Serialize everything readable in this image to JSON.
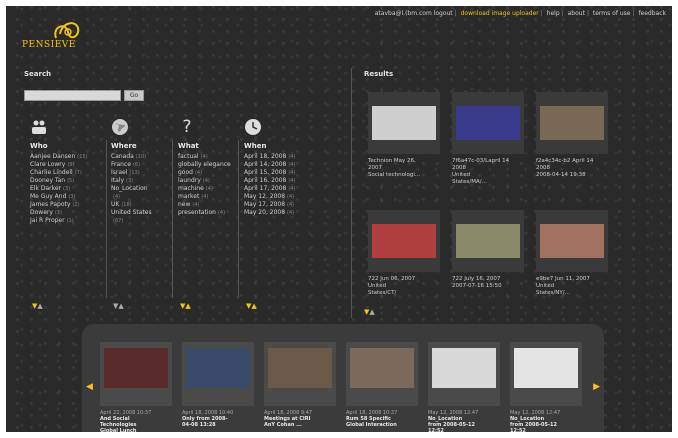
{
  "top_links": {
    "user": "atavba@l.(bm.com logout",
    "download": "download image uploader",
    "help": "help",
    "about": "about",
    "terms": "terms of use",
    "feedback": "feedback"
  },
  "logo": {
    "text": "PENSIEVE"
  },
  "search": {
    "title": "Search",
    "placeholder": "",
    "value": "",
    "go_label": "Go"
  },
  "columns": {
    "who": {
      "head": "Who",
      "items": [
        {
          "label": "Aanjee Dansen",
          "count": "(15)"
        },
        {
          "label": "Clare Lowry",
          "count": "(9)"
        },
        {
          "label": "Charlie Lindell",
          "count": "(7)"
        },
        {
          "label": "Dooney Tan",
          "count": "(5)"
        },
        {
          "label": "Elk Darker",
          "count": "(3)"
        },
        {
          "label": "Me Guy And",
          "count": "(3)"
        },
        {
          "label": "James Papoty",
          "count": "(2)"
        },
        {
          "label": "Dowery",
          "count": "(1)"
        },
        {
          "label": "Jai R Proper",
          "count": "(1)"
        }
      ]
    },
    "where": {
      "head": "Where",
      "items": [
        {
          "label": "Canada",
          "count": "(10)"
        },
        {
          "label": "France",
          "count": "(6)"
        },
        {
          "label": "Israel",
          "count": "(13)"
        },
        {
          "label": "Italy",
          "count": "(3)"
        },
        {
          "label": "No_Location",
          "count": ""
        },
        {
          "label": "",
          "count": "(4)"
        },
        {
          "label": "UK",
          "count": "(18)"
        },
        {
          "label": "United States",
          "count": ""
        },
        {
          "label": "",
          "count": "(67)"
        }
      ]
    },
    "what": {
      "head": "What",
      "items": [
        {
          "label": "factual",
          "count": "(4)"
        },
        {
          "label": "globally elegance",
          "count": ""
        },
        {
          "label": "good",
          "count": "(4)"
        },
        {
          "label": "laundry",
          "count": "(4)"
        },
        {
          "label": "machine",
          "count": "(4)"
        },
        {
          "label": "market",
          "count": "(4)"
        },
        {
          "label": "new",
          "count": "(4)"
        },
        {
          "label": "presentation",
          "count": "(4)"
        }
      ]
    },
    "when": {
      "head": "When",
      "items": [
        {
          "label": "April 18, 2008",
          "count": "(4)"
        },
        {
          "label": "April 14, 2008",
          "count": "(4)"
        },
        {
          "label": "April 15, 2008",
          "count": "(4)"
        },
        {
          "label": "April 16, 2008",
          "count": "(4)"
        },
        {
          "label": "April 17, 2008",
          "count": "(4)"
        },
        {
          "label": "May 12, 2008",
          "count": "(4)"
        },
        {
          "label": "May 17, 2008",
          "count": "(4)"
        },
        {
          "label": "May 20, 2008",
          "count": "(4)"
        }
      ]
    }
  },
  "results": {
    "title": "Results",
    "items": [
      {
        "line1": "Technion May 26,",
        "line2": "2007",
        "line3": "Social technologi...",
        "color": "#cfcfcf"
      },
      {
        "line1": "7f6a47c-03/Lapril 14",
        "line2": "2008",
        "line3": "United",
        "line4": "States/MA/...",
        "color": "#3a3a8a"
      },
      {
        "line1": "f2a4c34c-b2 April 14",
        "line2": "2008",
        "line3": "2008-04-14 19:38",
        "color": "#7a6a55"
      },
      {
        "line1": "722 Jun 06, 2007",
        "line2": "United",
        "line3": "States/CT/",
        "color": "#b04040"
      },
      {
        "line1": "722 July 16, 2007",
        "line2": "2007-07-16 15:50",
        "color": "#8a8a6a"
      },
      {
        "line1": "e9be7 Jun 11, 2007",
        "line2": "United",
        "line3": "States/NY/...",
        "color": "#a07060"
      }
    ]
  },
  "strip": {
    "items": [
      {
        "line1": "April 22, 2008 10:37",
        "title": "And Social",
        "line3": "Technologies",
        "line4": "Global Lunch",
        "color": "#5a2a2a"
      },
      {
        "line1": "April 18, 2008 10:40",
        "title": "Only from 2008-",
        "line3": "04-08 13:28",
        "color": "#3a4a6a"
      },
      {
        "line1": "April 18, 2008 9:47",
        "title": "Meetings at CIRI",
        "line3": "AnY Cohan ...",
        "color": "#6a5a4a"
      },
      {
        "line1": "April 18, 2008 10:37",
        "title": "Rum 58 Specific",
        "line3": "Global Interaction",
        "color": "#7a6a5a"
      },
      {
        "line1": "May 12, 2008 12:47",
        "title": "No_Location",
        "line3": "from 2008-05-12",
        "line4": "12:52",
        "color": "#d8d8d8"
      },
      {
        "line1": "May 12, 2008 12:47",
        "title": "No_Location",
        "line3": "from 2008-05-12",
        "line4": "12:52",
        "color": "#e4e4e4"
      }
    ]
  },
  "colors": {
    "accent": "#f4c21a",
    "background": "#2a2a2a"
  }
}
